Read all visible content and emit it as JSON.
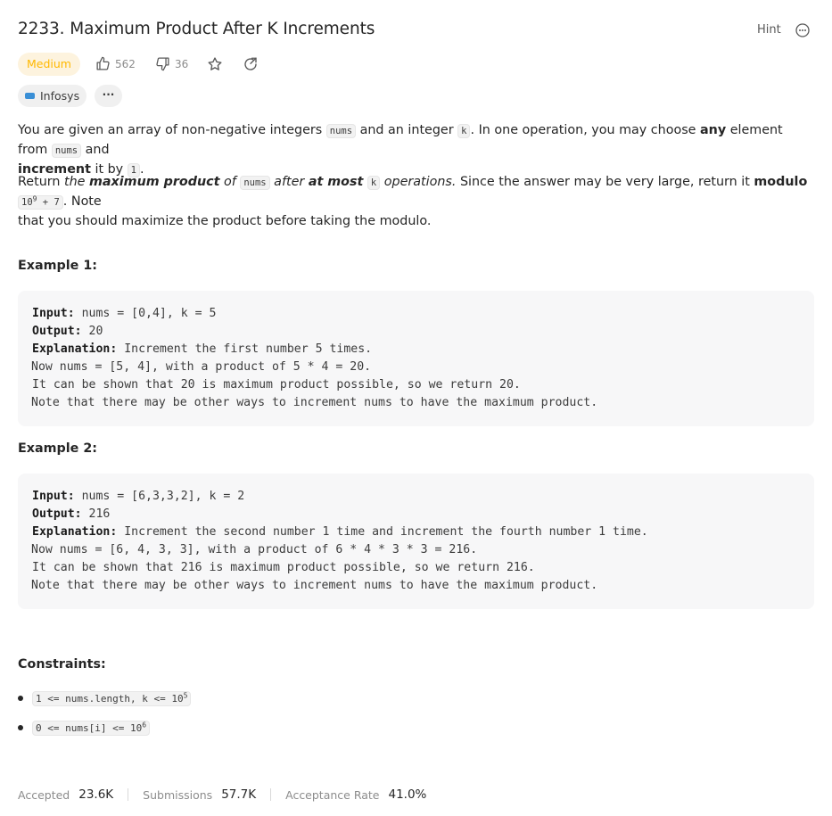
{
  "problem": {
    "title": "2233. Maximum Product After K Increments",
    "hint_label": "Hint",
    "difficulty": "Medium",
    "likes": "562",
    "dislikes": "36",
    "company": "Infosys",
    "company_more": "···"
  },
  "description": {
    "p1_a": "You are given an array of non-negative integers ",
    "p1_code1": "nums",
    "p1_b": " and an integer ",
    "p1_code2": "k",
    "p1_c": ". In one operation, you may choose ",
    "p1_bold1": "any",
    "p1_d": " element from ",
    "p1_code3": "nums",
    "p1_e": " and",
    "p1_bold2": "increment",
    "p1_f": " it by ",
    "p1_code4": "1",
    "p1_g": ".",
    "p2_a": "Return ",
    "p2_i1": "the ",
    "p2_bi1": "maximum product",
    "p2_i2": " of ",
    "p2_code1": "nums",
    "p2_i3": " after ",
    "p2_bi2": "at most",
    "p2_code2": "k",
    "p2_i4": " operations.",
    "p2_b": " Since the answer may be very large, return it ",
    "p2_bold": "modulo",
    "p2_code3_base": "10",
    "p2_code3_exp": "9",
    "p2_code3_rest": " + 7",
    "p2_c": ". Note",
    "p2_d": "that you should maximize the product before taking the modulo."
  },
  "examples": [
    {
      "heading": "Example 1:",
      "input_label": "Input:",
      "input": " nums = [0,4], k = 5",
      "output_label": "Output:",
      "output": " 20",
      "explanation_label": "Explanation:",
      "explanation": " Increment the first number 5 times.",
      "lines": [
        "Now nums = [5, 4], with a product of 5 * 4 = 20.",
        "It can be shown that 20 is maximum product possible, so we return 20.",
        "Note that there may be other ways to increment nums to have the maximum product."
      ]
    },
    {
      "heading": "Example 2:",
      "input_label": "Input:",
      "input": " nums = [6,3,3,2], k = 2",
      "output_label": "Output:",
      "output": " 216",
      "explanation_label": "Explanation:",
      "explanation": " Increment the second number 1 time and increment the fourth number 1 time.",
      "lines": [
        "Now nums = [6, 4, 3, 3], with a product of 6 * 4 * 3 * 3 = 216.",
        "It can be shown that 216 is maximum product possible, so we return 216.",
        "Note that there may be other ways to increment nums to have the maximum product."
      ]
    }
  ],
  "constraints": {
    "heading": "Constraints:",
    "c1_text": "1 <= nums.length, k <= 10",
    "c1_exp": "5",
    "c2_text": "0 <= nums[i] <= 10",
    "c2_exp": "6"
  },
  "stats": {
    "accepted_label": "Accepted",
    "accepted": "23.6K",
    "submissions_label": "Submissions",
    "submissions": "57.7K",
    "rate_label": "Acceptance Rate",
    "rate": "41.0%"
  }
}
